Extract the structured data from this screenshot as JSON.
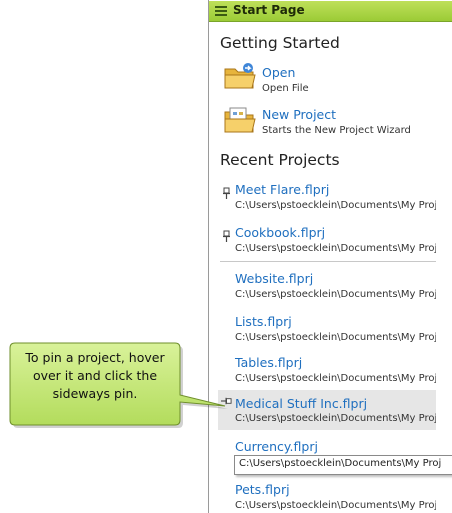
{
  "start_page": {
    "title": "Start Page",
    "getting_started": {
      "heading": "Getting Started",
      "open": {
        "label": "Open",
        "desc": "Open File"
      },
      "new_project": {
        "label": "New Project",
        "desc": "Starts the New Project Wizard"
      }
    },
    "recent": {
      "heading": "Recent Projects",
      "pinned": [
        {
          "name": "Meet Flare.flprj",
          "path": "C:\\Users\\pstoecklein\\Documents\\My Proj"
        },
        {
          "name": "Cookbook.flprj",
          "path": "C:\\Users\\pstoecklein\\Documents\\My Proj"
        }
      ],
      "items": [
        {
          "name": "Website.flprj",
          "path": "C:\\Users\\pstoecklein\\Documents\\My Proj"
        },
        {
          "name": "Lists.flprj",
          "path": "C:\\Users\\pstoecklein\\Documents\\My Proj"
        },
        {
          "name": "Tables.flprj",
          "path": "C:\\Users\\pstoecklein\\Documents\\My Proj"
        },
        {
          "name": "Medical Stuff Inc.flprj",
          "path": "C:\\Users\\pstoecklein\\Documents\\My Proj"
        },
        {
          "name": "Currency.flprj",
          "path": ""
        },
        {
          "name": "Pets.flprj",
          "path": "C:\\Users\\pstoecklein\\Documents\\My Proj"
        }
      ]
    },
    "tooltip": "C:\\Users\\pstoecklein\\Documents\\My Proj"
  },
  "callout": {
    "line1": "To pin a project, hover",
    "line2": "over it and click the",
    "line3": "sideways pin."
  },
  "colors": {
    "title_bar": "#9bcb36",
    "link": "#1f6fbf",
    "callout_fill": "#c6e87a",
    "hover_row": "#e6e6e6"
  }
}
